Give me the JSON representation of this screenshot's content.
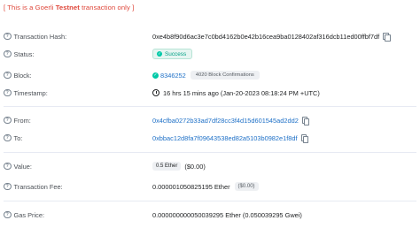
{
  "banner": {
    "prefix": "[ This is a Goerli ",
    "highlight": "Testnet",
    "suffix": " transaction only ]"
  },
  "rows": {
    "hash": {
      "label": "Transaction Hash:",
      "value": "0xe4b8f90d6ac3e7c0bd4162b0e42b16cea9ba0128402af316dcb11ed00ffbf7df"
    },
    "status": {
      "label": "Status:",
      "value": "Success"
    },
    "block": {
      "label": "Block:",
      "value": "8346252",
      "confirmations": "4020 Block Confirmations"
    },
    "timestamp": {
      "label": "Timestamp:",
      "value": "16 hrs 15 mins ago (Jan-20-2023 08:18:24 PM +UTC)"
    },
    "from": {
      "label": "From:",
      "value": "0x4cfba0272b33ad7df28cc3f4d15d601545ad2dd2"
    },
    "to": {
      "label": "To:",
      "value": "0xbbac12d8fa7f09643538ed82a5103b0982e1f8df"
    },
    "value": {
      "label": "Value:",
      "badge": "0.5 Ether",
      "usd": "($0.00)"
    },
    "fee": {
      "label": "Transaction Fee:",
      "value": "0.000001050825195 Ether",
      "usd": "($0.00)"
    },
    "gas": {
      "label": "Gas Price:",
      "value": "0.000000000050039295 Ether (0.050039295 Gwei)"
    }
  },
  "colors": {
    "accent": "#1e70c7",
    "success": "#00c9a7",
    "banner": "#de4437"
  }
}
